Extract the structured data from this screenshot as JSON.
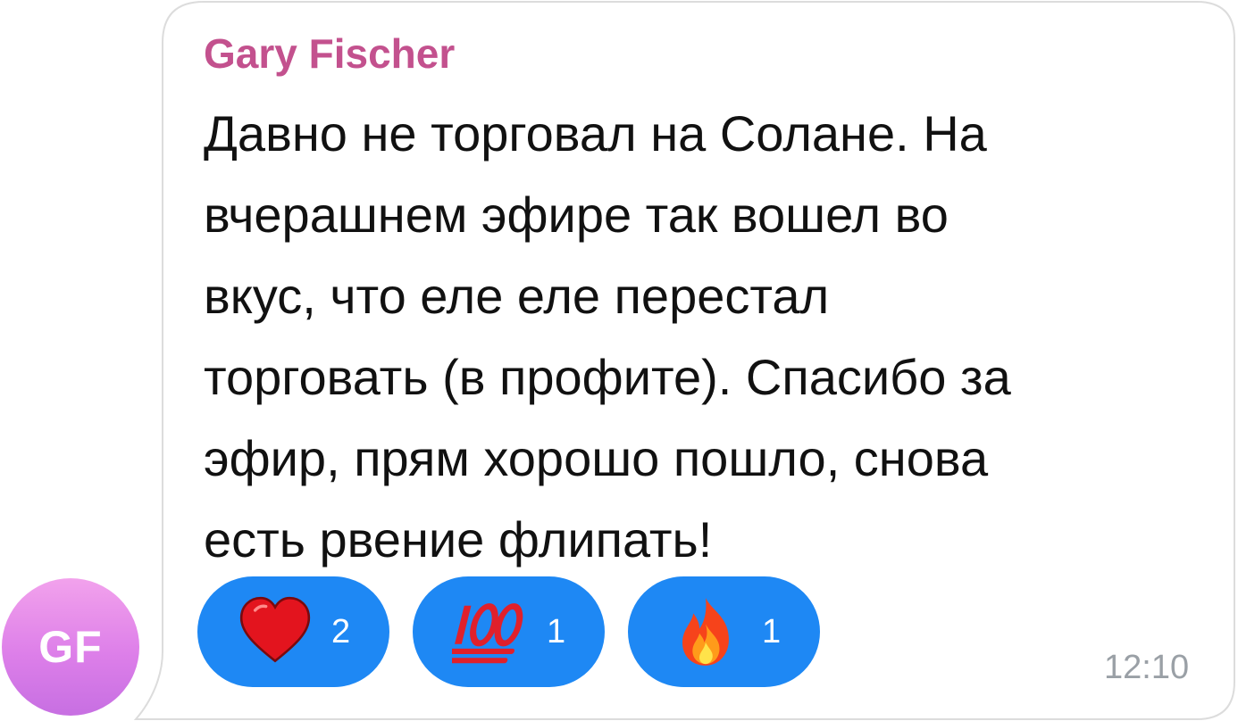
{
  "message": {
    "sender_name": "Gary Fischer",
    "text_lines": [
      "Давно не торговал на Солане. На",
      "вчерашнем эфире так вошел во",
      "вкус, что еле еле перестал",
      "торговать (в профите). Спасибо за",
      "эфир, прям хорошо пошло, снова",
      "есть рвение флипать!"
    ],
    "timestamp": "12:10"
  },
  "avatar": {
    "initials": "GF"
  },
  "reactions": [
    {
      "icon": "heart-icon",
      "count": "2"
    },
    {
      "icon": "hundred-points-icon",
      "count": "1"
    },
    {
      "icon": "fire-icon",
      "count": "1"
    }
  ],
  "colors": {
    "sender_name": "#c3518e",
    "reaction_pill": "#1e88f4",
    "avatar_gradient_top": "#f2a2ec",
    "avatar_gradient_bottom": "#c76fe2",
    "timestamp": "#9aa0a6",
    "bubble_border": "#dcdcdc"
  }
}
